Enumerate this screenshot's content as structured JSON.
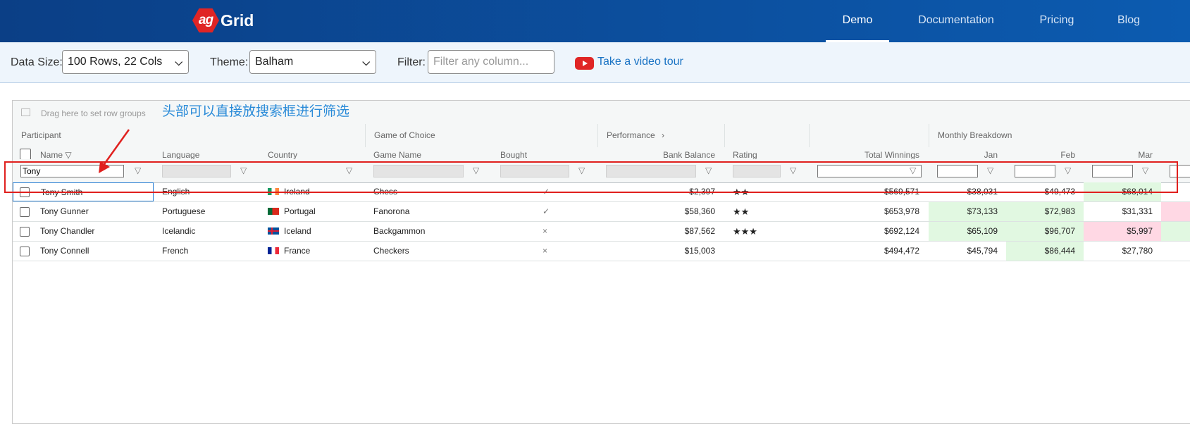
{
  "navbar": {
    "logo_mark": "ag",
    "logo_text": "Grid",
    "items": [
      {
        "label": "Demo",
        "active": true
      },
      {
        "label": "Documentation",
        "active": false
      },
      {
        "label": "Pricing",
        "active": false
      },
      {
        "label": "Blog",
        "active": false
      }
    ]
  },
  "toolbar": {
    "data_size_label": "Data Size:",
    "data_size_value": "100 Rows, 22 Cols",
    "theme_label": "Theme:",
    "theme_value": "Balham",
    "filter_label": "Filter:",
    "filter_placeholder": "Filter any column...",
    "video_link": "Take a video tour"
  },
  "grid": {
    "group_bar_text": "Drag here to set row groups",
    "annotation": "头部可以直接放搜索框进行筛选",
    "column_groups": [
      "Participant",
      "Game of Choice",
      "Performance",
      "Monthly Breakdown"
    ],
    "performance_chevron": "›",
    "columns": {
      "name": "Name",
      "language": "Language",
      "country": "Country",
      "game_name": "Game Name",
      "bought": "Bought",
      "bank_balance": "Bank Balance",
      "rating": "Rating",
      "total_winnings": "Total Winnings",
      "jan": "Jan",
      "feb": "Feb",
      "mar": "Mar"
    },
    "name_filter_value": "Tony",
    "rows": [
      {
        "name": "Tony Smith",
        "language": "English",
        "country": "Ireland",
        "flag": "ireland",
        "game": "Chess",
        "bought": "✓",
        "bank": "$2,397",
        "rating": "★★",
        "total": "$569,571",
        "jan": "$38,031",
        "feb": "$49,473",
        "mar": "$68,014",
        "jan_state": "none",
        "feb_state": "none",
        "mar_state": "green",
        "apr_state": "none"
      },
      {
        "name": "Tony Gunner",
        "language": "Portuguese",
        "country": "Portugal",
        "flag": "portugal",
        "game": "Fanorona",
        "bought": "✓",
        "bank": "$58,360",
        "rating": "★★",
        "total": "$653,978",
        "jan": "$73,133",
        "feb": "$72,983",
        "mar": "$31,331",
        "jan_state": "green",
        "feb_state": "green",
        "mar_state": "none",
        "apr_state": "pink"
      },
      {
        "name": "Tony Chandler",
        "language": "Icelandic",
        "country": "Iceland",
        "flag": "iceland",
        "game": "Backgammon",
        "bought": "×",
        "bank": "$87,562",
        "rating": "★★★",
        "total": "$692,124",
        "jan": "$65,109",
        "feb": "$96,707",
        "mar": "$5,997",
        "jan_state": "green",
        "feb_state": "green",
        "mar_state": "pink",
        "apr_state": "green"
      },
      {
        "name": "Tony Connell",
        "language": "French",
        "country": "France",
        "flag": "france",
        "game": "Checkers",
        "bought": "×",
        "bank": "$15,003",
        "rating": "",
        "total": "$494,472",
        "jan": "$45,794",
        "feb": "$86,444",
        "mar": "$27,780",
        "jan_state": "none",
        "feb_state": "green",
        "mar_state": "none",
        "apr_state": "none"
      }
    ]
  },
  "colors": {
    "navbar_start": "#0b3f86",
    "navbar_end": "#0c5bb0",
    "accent_link": "#1a73c4",
    "annotation_red": "#e0201e",
    "cell_green": "#e1f8e1",
    "cell_pink": "#ffd8e4"
  }
}
